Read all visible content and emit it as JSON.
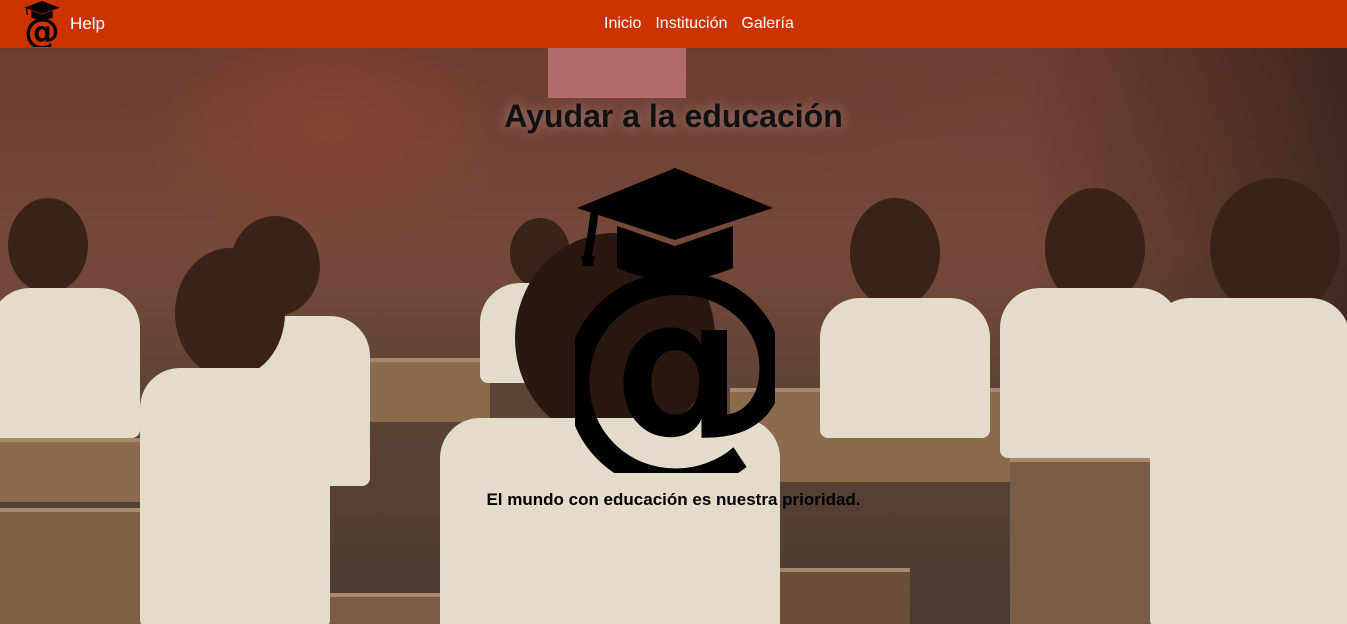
{
  "navbar": {
    "brand_text": "Help",
    "background_color": "#cc3300",
    "links": [
      {
        "label": "Inicio"
      },
      {
        "label": "Institución"
      },
      {
        "label": "Galería"
      }
    ]
  },
  "hero": {
    "title": "Ayudar a la educación",
    "subtitle": "El mundo con educación es nuestra prioridad.",
    "logo_icon": "graduation-cap-at-icon",
    "background_image": "classroom-students-photo"
  }
}
